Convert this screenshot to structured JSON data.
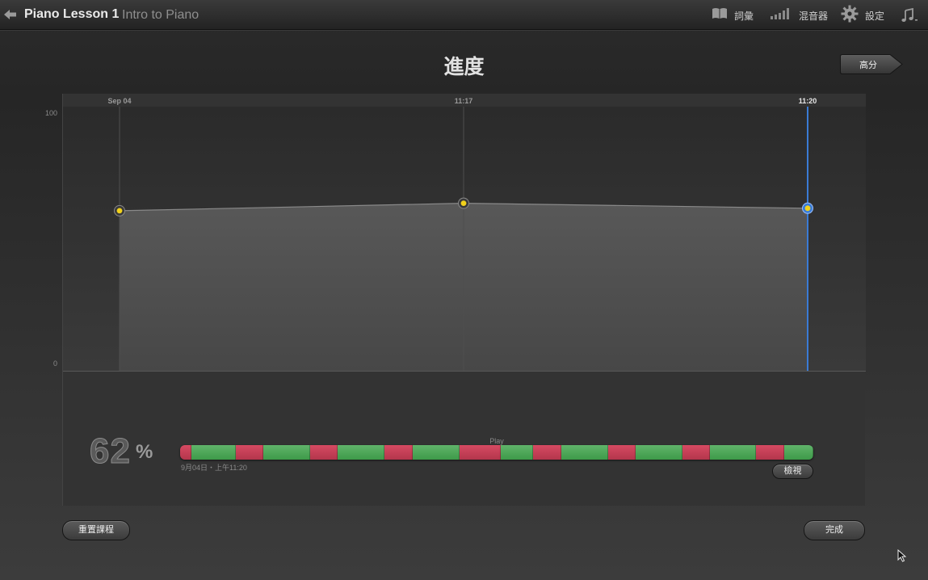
{
  "header": {
    "lesson_title": "Piano Lesson 1",
    "lesson_subtitle": "Intro to Piano",
    "glossary_label": "詞彙",
    "mixer_label": "混音器",
    "settings_label": "設定",
    "icons": [
      "back-arrow-icon",
      "book-icon",
      "mixer-icon",
      "gear-icon",
      "music-note-icon"
    ]
  },
  "page": {
    "title": "進度",
    "high_score_label": "高分"
  },
  "chart_data": {
    "type": "area",
    "x": [
      "Sep 04",
      "11:17",
      "11:20"
    ],
    "values": [
      61,
      64,
      62
    ],
    "ylim": [
      0,
      100
    ],
    "yticks": [
      "100",
      "0"
    ],
    "selected_index": 2,
    "colors": {
      "point": "#f2d21b",
      "selected_ring": "#3a7bd5",
      "area": "#555555"
    }
  },
  "result": {
    "percent": "62",
    "percent_sign": "%",
    "section_label": "Play",
    "date_label": "9月04日・上午11:20",
    "view_label": "檢視",
    "timeline": [
      {
        "q": "bad",
        "w": 1.8
      },
      {
        "q": "good",
        "w": 7.0
      },
      {
        "q": "bad",
        "w": 4.4
      },
      {
        "q": "good",
        "w": 7.4
      },
      {
        "q": "bad",
        "w": 4.3
      },
      {
        "q": "good",
        "w": 7.5
      },
      {
        "q": "bad",
        "w": 4.4
      },
      {
        "q": "good",
        "w": 7.4
      },
      {
        "q": "bad",
        "w": 6.5
      },
      {
        "q": "good",
        "w": 5.2
      },
      {
        "q": "bad",
        "w": 4.4
      },
      {
        "q": "good",
        "w": 7.4
      },
      {
        "q": "bad",
        "w": 4.4
      },
      {
        "q": "good",
        "w": 7.4
      },
      {
        "q": "bad",
        "w": 4.4
      },
      {
        "q": "good",
        "w": 7.3
      },
      {
        "q": "bad",
        "w": 4.4
      },
      {
        "q": "good",
        "w": 4.6
      }
    ]
  },
  "footer": {
    "reset_label": "重置課程",
    "done_label": "完成"
  }
}
